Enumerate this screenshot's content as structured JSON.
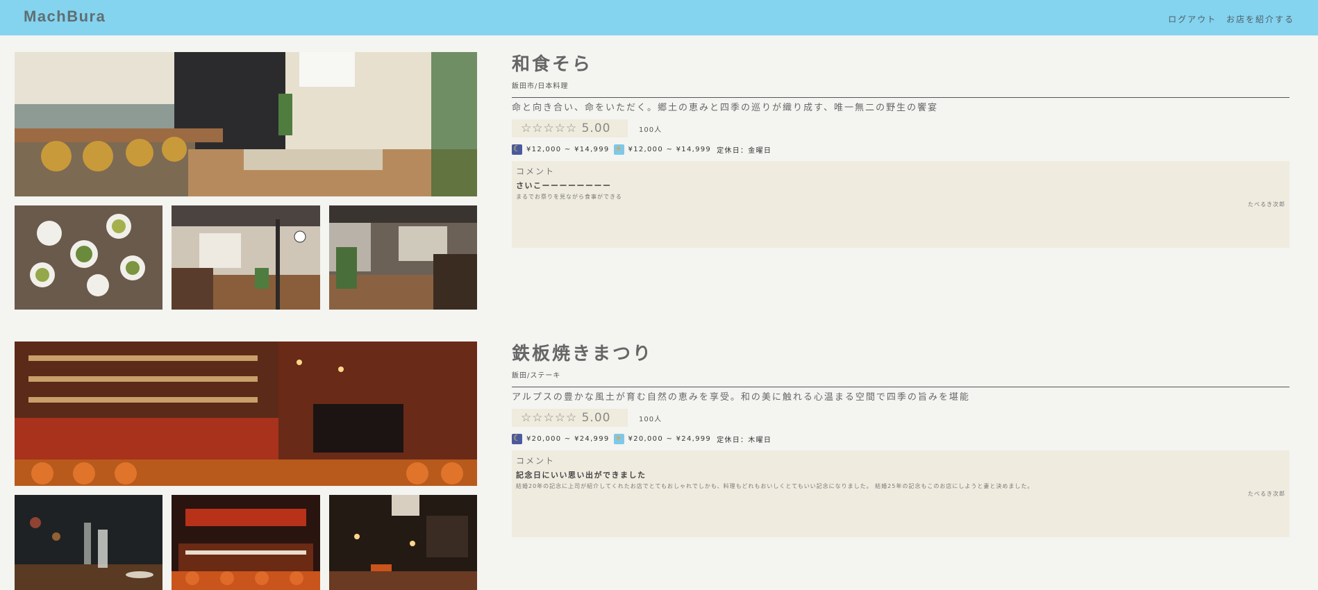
{
  "header": {
    "logo": "MachBura",
    "nav": [
      "ログアウト",
      "お店を紹介する"
    ]
  },
  "shops": [
    {
      "name": "和食そら",
      "meta": "飯田市/日本料理",
      "description": "命と向き合い、命をいただく。郷土の恵みと四季の巡りが織り成す、唯一無二の野生の饗宴",
      "stars": "☆☆☆☆☆",
      "score": "5.00",
      "reviewers": "100人",
      "dinner_price": "¥12,000 ~ ¥14,999",
      "lunch_price": "¥12,000 ~ ¥14,999",
      "holiday": "定休日：金曜日",
      "comment": {
        "heading": "コメント",
        "title": "さいこーーーーーーーー",
        "body": "まるでお祭りを見ながら食事ができる",
        "author": "たべるき次郎"
      }
    },
    {
      "name": "鉄板焼きまつり",
      "meta": "飯田/ステーキ",
      "description": "アルプスの豊かな風土が育む自然の恵みを享受。和の美に触れる心温まる空間で四季の旨みを堪能",
      "stars": "☆☆☆☆☆",
      "score": "5.00",
      "reviewers": "100人",
      "dinner_price": "¥20,000 ~ ¥24,999",
      "lunch_price": "¥20,000 ~ ¥24,999",
      "holiday": "定休日：木曜日",
      "comment": {
        "heading": "コメント",
        "title": "記念日にいい思い出ができました",
        "body": "結婚20年の記念に上司が紹介してくれたお店でとてもおしゃれでしかも、料理もどれもおいしくとてもいい記念になりました。 結婚25年の記念もこのお店にしようと妻と決めました。",
        "author": "たべるき次郎"
      }
    }
  ],
  "icons": {
    "dinner": "moon-icon",
    "lunch": "sun-icon"
  },
  "colors": {
    "header_bg": "#84d3ef",
    "page_bg": "#f4f4f1",
    "comment_bg": "#efebdf"
  }
}
